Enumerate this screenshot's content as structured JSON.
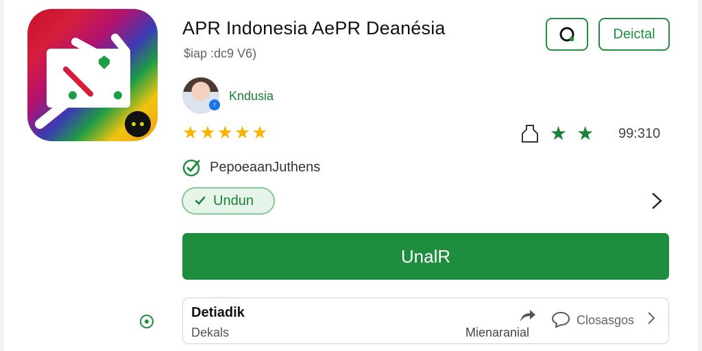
{
  "app": {
    "title": "APR Indonesia AePR Deanésia",
    "subtitle": "$iap :dc9 V6)",
    "developer": "Kndusia",
    "rating_stars": "★★★★★",
    "stat_value": "99:310"
  },
  "header": {
    "secondary_button": "Deictal"
  },
  "feature": {
    "text": "PepoeaanJuthens"
  },
  "chip": {
    "label": "Undun"
  },
  "primary_button": {
    "label": "UnalR"
  },
  "details": {
    "title": "Detiadik",
    "subtitle": "Dekals",
    "middle": "Mienaranial",
    "action": "Closasgos"
  },
  "colors": {
    "accent": "#1e8e3e",
    "star": "#f4b400",
    "chip_bg": "#e6f4ea"
  },
  "icons": [
    "app-icon",
    "verified-icon",
    "clipboard-icon",
    "green-star-icon",
    "check-circle-icon",
    "check-icon",
    "chevron-right-icon",
    "share-icon",
    "comment-icon",
    "record-icon"
  ]
}
